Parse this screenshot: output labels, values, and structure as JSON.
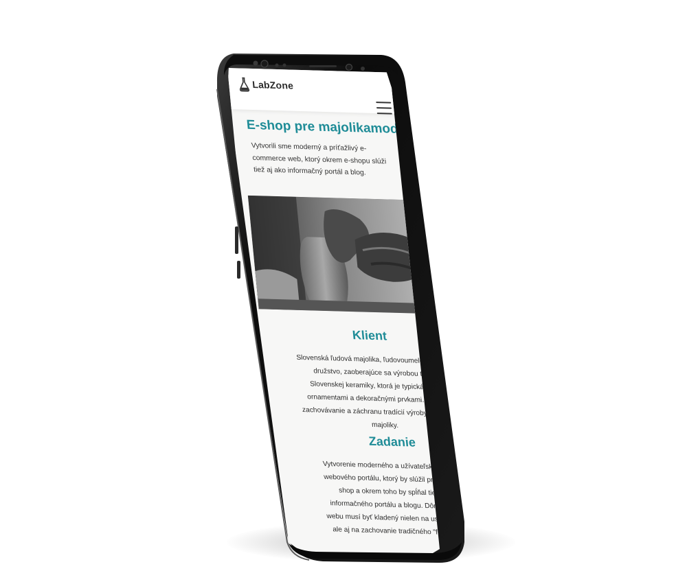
{
  "app": {
    "brand": "LabZone",
    "menu_icon": "hamburger-menu-icon",
    "logo_icon": "flask-icon"
  },
  "hero": {
    "title": "E-shop pre majolikamodra.sk",
    "description": "Vytvorili sme moderný a príťažlivý e-commerce web, ktorý okrem e-shopu slúži tiež aj ako informačný portál a blog."
  },
  "client": {
    "title": "Klient",
    "text": "Slovenská ľudová majolika, ľudovoumelecké výrobné družstvo, zaoberajúce sa výrobou tradičnej Slovenskej keramiky, ktorá je typická zložitými ornamentami a dekoračnými prvkami. Podporujú zachovávanie a záchranu tradícií výroby modranskej majoliky."
  },
  "assignment": {
    "title": "Zadanie",
    "text": "Vytvorenie moderného a užívateľsky príťažlivého webového portálu, ktorý by slúžil primárne ako e-shop a okrem toho by spĺňal tiež funkcie informačného portálu a blogu. Dôraz pri tvorbe webu musí byť kladený nielen na user experience ale aj na zachovanie tradičného \"feelu\" značky"
  },
  "colors": {
    "accent": "#1f8c97",
    "phone_frame": "#111111"
  }
}
